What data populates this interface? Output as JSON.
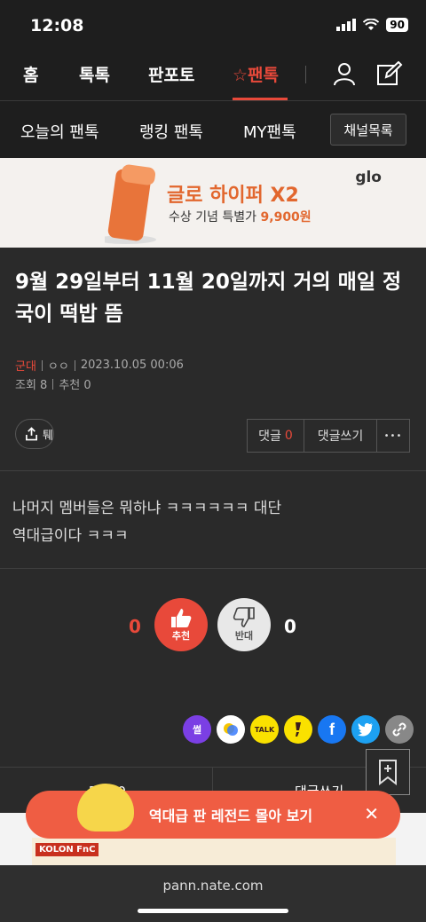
{
  "status": {
    "time": "12:08",
    "battery": "90"
  },
  "nav": {
    "home": "홈",
    "toktok": "톡톡",
    "panpoto": "판포토",
    "pantalk": "☆팬톡"
  },
  "subnav": {
    "today": "오늘의 팬톡",
    "ranking": "랭킹 팬톡",
    "my": "MY팬톡",
    "channel": "채널목록"
  },
  "ad": {
    "title": "글로 하이퍼 X2",
    "subtitle_prefix": "수상 기념 특별가 ",
    "price": "9,900원",
    "logo": "glo"
  },
  "post": {
    "title": "9월 29일부터 11월 20일까지 거의 매일 정국이 떡밥 뜸",
    "category": "군대",
    "author": "ㅇㅇ",
    "date": "2023.10.05 00:06",
    "views_label": "조회 8",
    "recommend_label": "추천 0",
    "body_line1": "나머지 멤버들은 뭐하냐 ㅋㅋㅋㅋㅋㅋ 대단",
    "body_line2": "역대급이다 ㅋㅋㅋ"
  },
  "actions": {
    "share_label": "퉤",
    "comment_label": "댓글",
    "comment_count": "0",
    "write_comment": "댓글쓰기",
    "more": "•••"
  },
  "votes": {
    "up_count": "0",
    "up_label": "추천",
    "down_count": "0",
    "down_label": "반대"
  },
  "social": {
    "ssul": "썰",
    "talk": "TALK"
  },
  "bottom_tabs": {
    "comments": "댓글 0",
    "write": "댓글쓰기"
  },
  "legend_banner": {
    "text": "역대급 판 레전드 몰아 보기",
    "close": "✕"
  },
  "ad2": {
    "brand": "KOLON FnC"
  },
  "browser": {
    "url": "pann.nate.com"
  },
  "colors": {
    "accent": "#e8493a",
    "background": "#2a2a2a",
    "nav_bg": "#1e1e1e"
  }
}
